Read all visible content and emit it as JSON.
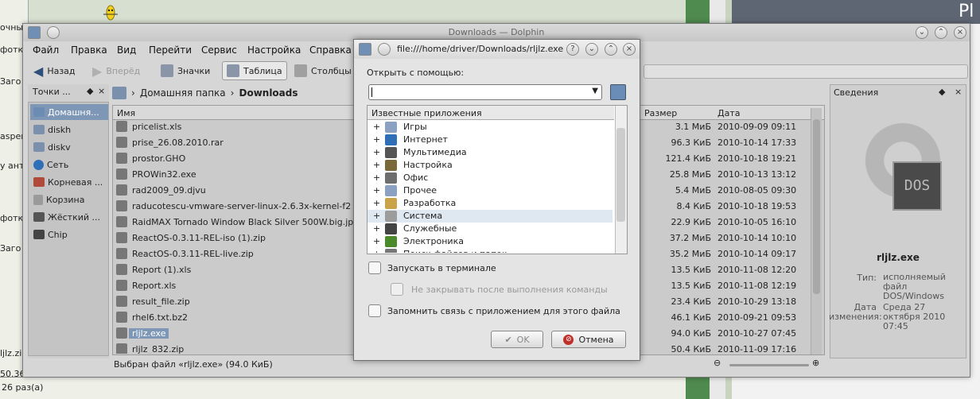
{
  "background": {
    "left_texts": [
      "очны",
      "фотки",
      "Заго",
      "asperь",
      "у анти",
      "фотки",
      "Заго",
      "ljlz.zip",
      "50.36",
      "26 раз(а)"
    ],
    "right_title": "Pl"
  },
  "dolphin": {
    "title": "Downloads — Dolphin",
    "menu": [
      "Файл",
      "Правка",
      "Вид",
      "Перейти",
      "Сервис",
      "Настройка",
      "Справка"
    ],
    "toolbar": {
      "back": "Назад",
      "forward": "Вперёд",
      "icons": "Значки",
      "table": "Таблица",
      "columns": "Столбцы"
    },
    "places": {
      "title": "Точки ...",
      "items": [
        "Домашня...",
        "diskh",
        "diskv",
        "Сеть",
        "Корневая ...",
        "Корзина",
        "Жёсткий ...",
        "Chip"
      ]
    },
    "breadcrumb": {
      "home": "Домашняя папка",
      "current": "Downloads"
    },
    "columns": {
      "name": "Имя",
      "size": "Размер",
      "date": "Дата"
    },
    "files": [
      {
        "name": "pricelist.xls",
        "size": "3.1 МиБ",
        "date": "2010-09-09 09:11"
      },
      {
        "name": "prise_26.08.2010.rar",
        "size": "96.3 КиБ",
        "date": "2010-10-14 17:33"
      },
      {
        "name": "prostor.GHO",
        "size": "121.4 КиБ",
        "date": "2010-10-18 19:21"
      },
      {
        "name": "PROWin32.exe",
        "size": "25.8 МиБ",
        "date": "2010-10-13 13:12"
      },
      {
        "name": "rad2009_09.djvu",
        "size": "5.4 МиБ",
        "date": "2010-08-05 09:30"
      },
      {
        "name": "raducotescu-vmware-server-linux-2.6.3x-kernel-f2",
        "size": "8.4 КиБ",
        "date": "2010-10-18 19:53"
      },
      {
        "name": "RaidMAX Tornado Window Black Silver 500W.big.jp",
        "size": "22.9 КиБ",
        "date": "2010-10-05 16:10"
      },
      {
        "name": "ReactOS-0.3.11-REL-iso (1).zip",
        "size": "37.2 МиБ",
        "date": "2010-10-14 10:10"
      },
      {
        "name": "ReactOS-0.3.11-REL-live.zip",
        "size": "35.2 МиБ",
        "date": "2010-10-14 09:17"
      },
      {
        "name": "Report (1).xls",
        "size": "13.5 КиБ",
        "date": "2010-11-08 12:20"
      },
      {
        "name": "Report.xls",
        "size": "13.5 КиБ",
        "date": "2010-11-08 12:19"
      },
      {
        "name": "result_file.zip",
        "size": "23.4 КиБ",
        "date": "2010-10-29 13:18"
      },
      {
        "name": "rhel6.txt.bz2",
        "size": "46.1 КиБ",
        "date": "2010-09-21 09:53"
      },
      {
        "name": "rljlz.exe",
        "size": "94.0 КиБ",
        "date": "2010-10-27 07:45",
        "selected": true
      },
      {
        "name": "rljlz_832.zip",
        "size": "50.4 КиБ",
        "date": "2010-11-09 17:16"
      }
    ],
    "status": "Выбран файл «rljlz.exe» (94.0 КиБ)",
    "info": {
      "title": "Сведения",
      "icon_text": "DOS",
      "filename": "rljlz.exe",
      "type_label": "Тип:",
      "type_value": "исполняемый файл DOS/Windows",
      "date_label": "Дата изменения:",
      "date_value": "Среда 27 октября 2010 07:45"
    }
  },
  "dialog": {
    "title": "file:///home/driver/Downloads/rljlz.exe —",
    "open_with_label": "Открыть с помощью:",
    "combo_value": "",
    "tree_header": "Известные приложения",
    "categories": [
      {
        "label": "Игры",
        "color": "#8aa1c2"
      },
      {
        "label": "Интернет",
        "color": "#2f6fb7"
      },
      {
        "label": "Мультимедиа",
        "color": "#555555"
      },
      {
        "label": "Настройка",
        "color": "#7a6a3a"
      },
      {
        "label": "Офис",
        "color": "#6e6e6e"
      },
      {
        "label": "Прочее",
        "color": "#8aa1c2"
      },
      {
        "label": "Разработка",
        "color": "#c9a24a"
      },
      {
        "label": "Система",
        "color": "#9c9c9c"
      },
      {
        "label": "Служебные",
        "color": "#444444"
      },
      {
        "label": "Электроника",
        "color": "#4a8a2a"
      },
      {
        "label": "Поиск файлов и папок",
        "color": "#777777"
      }
    ],
    "run_in_terminal": "Запускать в терминале",
    "keep_open": "Не закрывать после выполнения команды",
    "remember": "Запомнить связь с приложением для этого файла",
    "ok": "OK",
    "cancel": "Отмена"
  }
}
